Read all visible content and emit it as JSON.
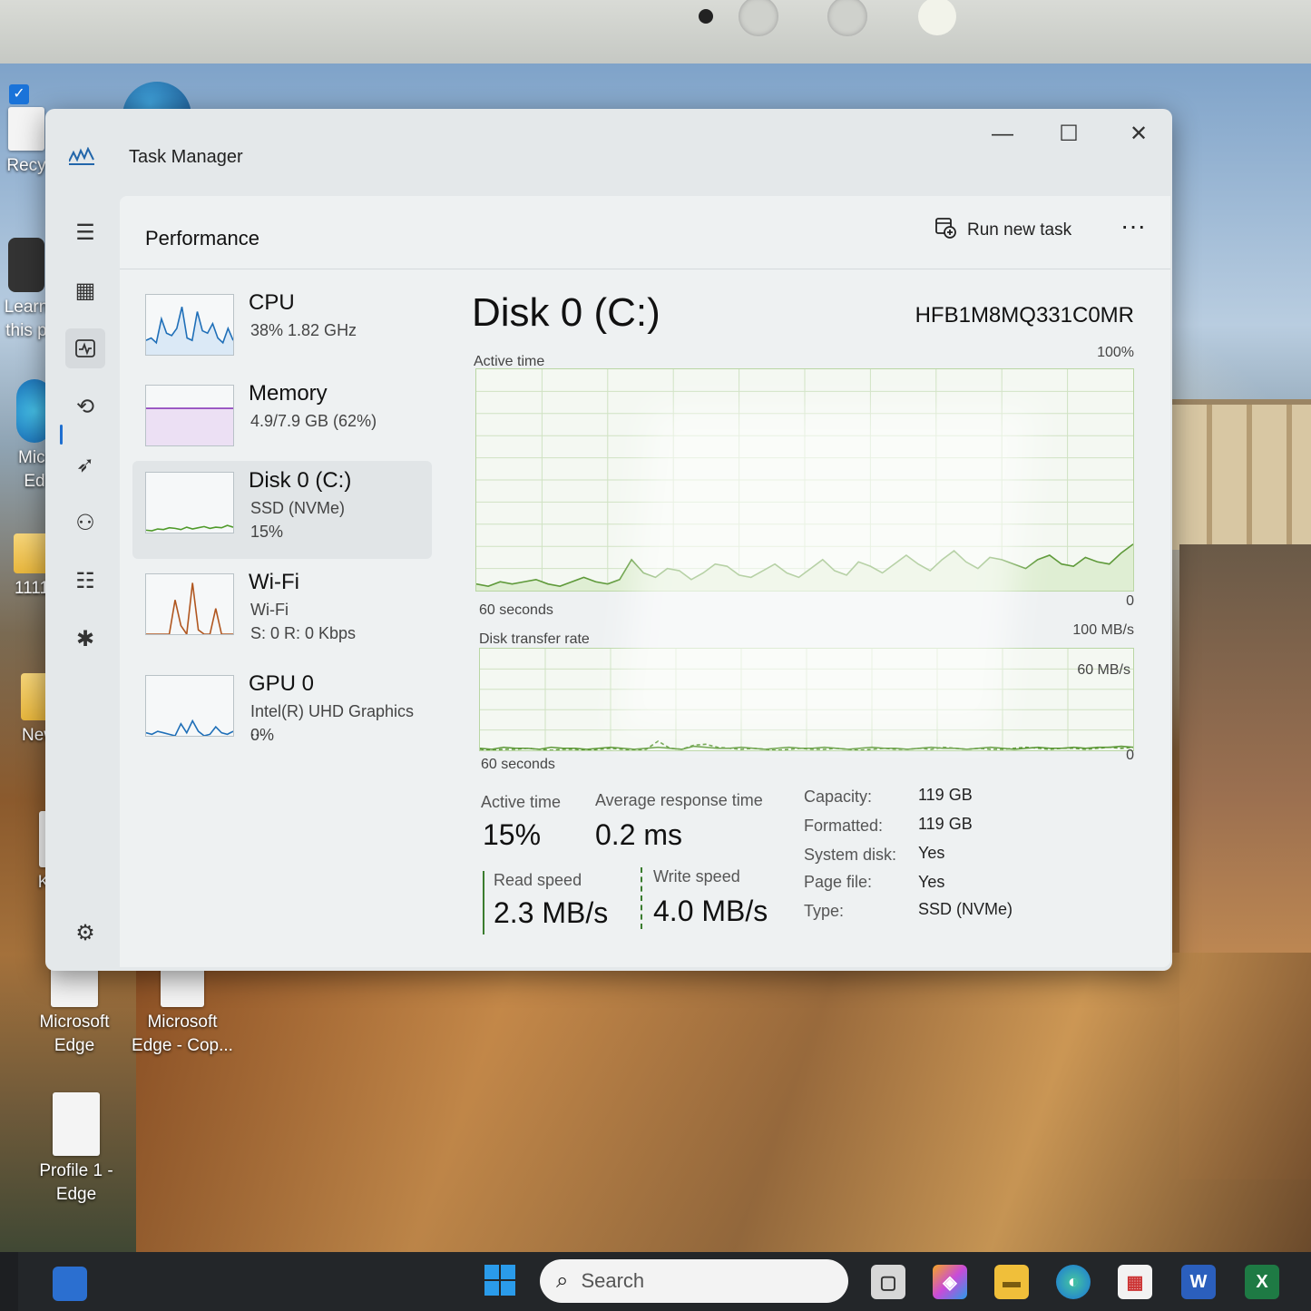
{
  "desktop": {
    "icons": [
      {
        "label_lines": [
          "Recy"
        ]
      },
      {
        "label_lines": [
          "Learn",
          "this p"
        ]
      },
      {
        "label_lines": [
          "Micr",
          "Ed"
        ]
      },
      {
        "label_lines": [
          "1111"
        ]
      },
      {
        "label_lines": [
          "New"
        ]
      },
      {
        "label_lines": [
          "KC"
        ]
      },
      {
        "label_lines": [
          "Microsoft",
          "Edge"
        ]
      },
      {
        "label_lines": [
          "Microsoft",
          "Edge - Cop..."
        ]
      },
      {
        "label_lines": [
          "Profile 1 -",
          "Edge"
        ]
      }
    ]
  },
  "window": {
    "title": "Task Manager",
    "controls": {
      "minimize": "—",
      "maximize": "☐",
      "close": "✕"
    }
  },
  "sidebar": {
    "items": [
      {
        "icon": "hamburger-menu-icon",
        "glyph": "☰"
      },
      {
        "icon": "processes-icon",
        "glyph": "▦"
      },
      {
        "icon": "performance-icon",
        "glyph": "⌁",
        "active": true
      },
      {
        "icon": "app-history-icon",
        "glyph": "⟲"
      },
      {
        "icon": "startup-apps-icon",
        "glyph": "➶"
      },
      {
        "icon": "users-icon",
        "glyph": "⚇"
      },
      {
        "icon": "details-icon",
        "glyph": "☷"
      },
      {
        "icon": "services-icon",
        "glyph": "✱"
      }
    ],
    "settings": {
      "icon": "settings-gear-icon",
      "glyph": "⚙"
    }
  },
  "header": {
    "title": "Performance",
    "run_new_task": "Run new task",
    "more": "···"
  },
  "devices": [
    {
      "name": "CPU",
      "line1": "38%  1.82 GHz",
      "line2": "",
      "color": "#1f6fb8"
    },
    {
      "name": "Memory",
      "line1": "4.9/7.9 GB (62%)",
      "line2": "",
      "color": "#8a3ab9"
    },
    {
      "name": "Disk 0 (C:)",
      "line1": "SSD (NVMe)",
      "line2": "15%",
      "color": "#4f9a2a"
    },
    {
      "name": "Wi-Fi",
      "line1": "Wi-Fi",
      "line2": "S: 0  R: 0 Kbps",
      "color": "#b0561f"
    },
    {
      "name": "GPU 0",
      "line1": "Intel(R) UHD Graphics ...",
      "line2": "0%",
      "color": "#1f6fb8"
    }
  ],
  "detail": {
    "title": "Disk 0 (C:)",
    "model": "HFB1M8MQ331C0MR",
    "active_graph": {
      "label": "Active time",
      "max": "100%",
      "min": "0",
      "time": "60 seconds"
    },
    "transfer_graph": {
      "label": "Disk transfer rate",
      "max": "100 MB/s",
      "mid": "60 MB/s",
      "min": "0",
      "time": "60 seconds"
    },
    "stats": {
      "active_time_label": "Active time",
      "active_time_value": "15%",
      "avg_response_label": "Average response time",
      "avg_response_value": "0.2 ms",
      "read_label": "Read speed",
      "read_value": "2.3 MB/s",
      "write_label": "Write speed",
      "write_value": "4.0 MB/s"
    },
    "properties": [
      {
        "key": "Capacity:",
        "value": "119 GB"
      },
      {
        "key": "Formatted:",
        "value": "119 GB"
      },
      {
        "key": "System disk:",
        "value": "Yes"
      },
      {
        "key": "Page file:",
        "value": "Yes"
      },
      {
        "key": "Type:",
        "value": "SSD (NVMe)"
      }
    ],
    "active_series": [
      3,
      2,
      4,
      3,
      4,
      5,
      3,
      2,
      4,
      6,
      4,
      3,
      5,
      14,
      8,
      6,
      10,
      9,
      5,
      8,
      12,
      11,
      7,
      6,
      9,
      12,
      8,
      6,
      10,
      14,
      9,
      7,
      13,
      11,
      8,
      12,
      16,
      12,
      9,
      14,
      18,
      13,
      10,
      15,
      14,
      12,
      10,
      14,
      16,
      12,
      11,
      15,
      13,
      12,
      17,
      21
    ],
    "read_series": [
      2,
      1,
      3,
      2,
      2,
      1,
      3,
      2,
      2,
      1,
      2,
      3,
      2,
      1,
      2,
      3,
      2,
      1,
      4,
      3,
      2,
      2,
      3,
      2,
      1,
      2,
      3,
      2,
      2,
      3,
      2,
      1,
      2,
      3,
      2,
      2,
      1,
      2,
      3,
      2,
      2,
      1,
      2,
      3,
      2,
      1,
      2,
      3,
      2,
      2,
      3,
      2,
      3,
      3,
      4,
      3
    ],
    "write_series": [
      1,
      0,
      1,
      1,
      2,
      1,
      0,
      1,
      1,
      0,
      1,
      2,
      1,
      0,
      1,
      9,
      2,
      1,
      5,
      6,
      3,
      2,
      1,
      2,
      1,
      0,
      1,
      2,
      1,
      1,
      2,
      1,
      0,
      1,
      2,
      1,
      1,
      2,
      1,
      3,
      2,
      1,
      2,
      1,
      1,
      2,
      3,
      2,
      1,
      2,
      2,
      1,
      2,
      3,
      2,
      3
    ],
    "colors": {
      "line": "#5f9a3a",
      "fill": "#dfeed3",
      "grid": "#cfe2c2"
    }
  },
  "thumbs": {
    "cpu": [
      12,
      14,
      10,
      30,
      18,
      16,
      22,
      40,
      14,
      12,
      36,
      20,
      18,
      26,
      14,
      10,
      22,
      12
    ],
    "memory": [
      62,
      62,
      62,
      62,
      62,
      62,
      62,
      62,
      62,
      62,
      62,
      62,
      62,
      62,
      62,
      62,
      62,
      62
    ],
    "disk": [
      4,
      3,
      6,
      5,
      8,
      7,
      5,
      9,
      6,
      8,
      10,
      7,
      9,
      8,
      12,
      9
    ],
    "wifi": [
      0,
      0,
      0,
      0,
      0,
      40,
      10,
      0,
      60,
      5,
      0,
      0,
      30,
      0,
      0,
      0
    ],
    "gpu": [
      2,
      1,
      3,
      2,
      1,
      0,
      8,
      2,
      10,
      3,
      0,
      1,
      6,
      2,
      1,
      3
    ]
  },
  "taskbar": {
    "search_placeholder": "Search",
    "apps": [
      {
        "icon": "task-view-icon",
        "glyph": "▢"
      },
      {
        "icon": "copilot-icon",
        "glyph": "◈"
      },
      {
        "icon": "file-explorer-icon",
        "glyph": "▬"
      },
      {
        "icon": "edge-icon",
        "glyph": "◐"
      },
      {
        "icon": "store-icon",
        "glyph": "▦"
      },
      {
        "icon": "word-icon",
        "glyph": "W"
      },
      {
        "icon": "excel-icon",
        "glyph": "X"
      }
    ]
  }
}
